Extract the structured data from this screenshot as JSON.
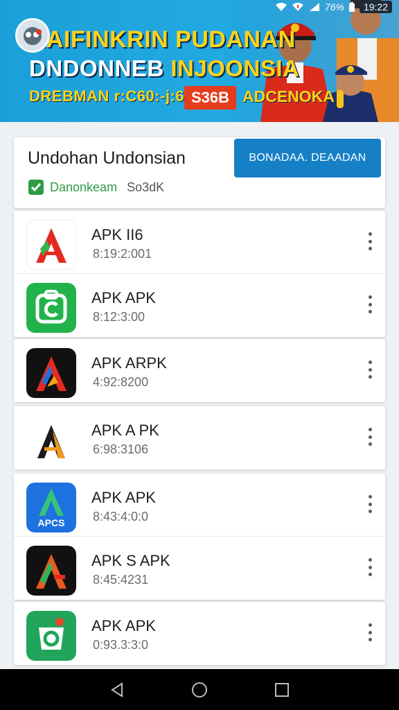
{
  "status_bar": {
    "battery": "76%",
    "time": "19:22"
  },
  "banner": {
    "line1": "MAIFINKRIN PUDANAN",
    "line2_a": "DNDONNEB",
    "line2_b": "INJOONSIA",
    "line3": "DREBMAN r:C60:-j:6",
    "badge": "S36B",
    "line4": "ADCENOKA"
  },
  "header": {
    "title": "Undohan Undonsian",
    "brand": "Danonkeam",
    "brand_sub": "So3dK",
    "button_label": "BONADAA. DEAADAN"
  },
  "apps": [
    {
      "name": "APK II6",
      "meta": "8:19:2:001",
      "icon": "apk-red-a-icon"
    },
    {
      "name": "APK APK",
      "meta": "8:12:3:00",
      "icon": "green-c-icon"
    },
    {
      "name": "APK ARPK",
      "meta": "4:92:8200",
      "icon": "dark-a-icon"
    },
    {
      "name": "APK A PK",
      "meta": "6:98:3106",
      "icon": "orange-a-icon"
    },
    {
      "name": "APK APK",
      "meta": "8:43:4:0:0",
      "icon": "blue-apcs-icon"
    },
    {
      "name": "APK S APK",
      "meta": "8:45:4231",
      "icon": "dark-a-green-icon"
    },
    {
      "name": "APK APK",
      "meta": "0:93.3:3:0",
      "icon": "green-o-icon"
    }
  ],
  "apps_icon_label": "APCS",
  "colors": {
    "accent": "#1680c6",
    "banner": "#23a9e1",
    "brand_green": "#2e9b45"
  }
}
